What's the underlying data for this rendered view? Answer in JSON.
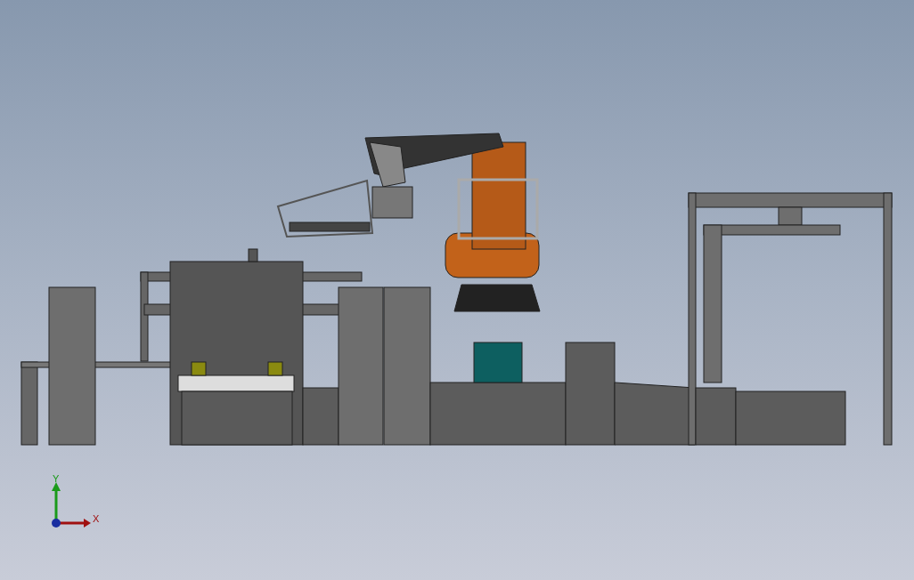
{
  "triad": {
    "y_label": "Y",
    "x_label": "X"
  }
}
